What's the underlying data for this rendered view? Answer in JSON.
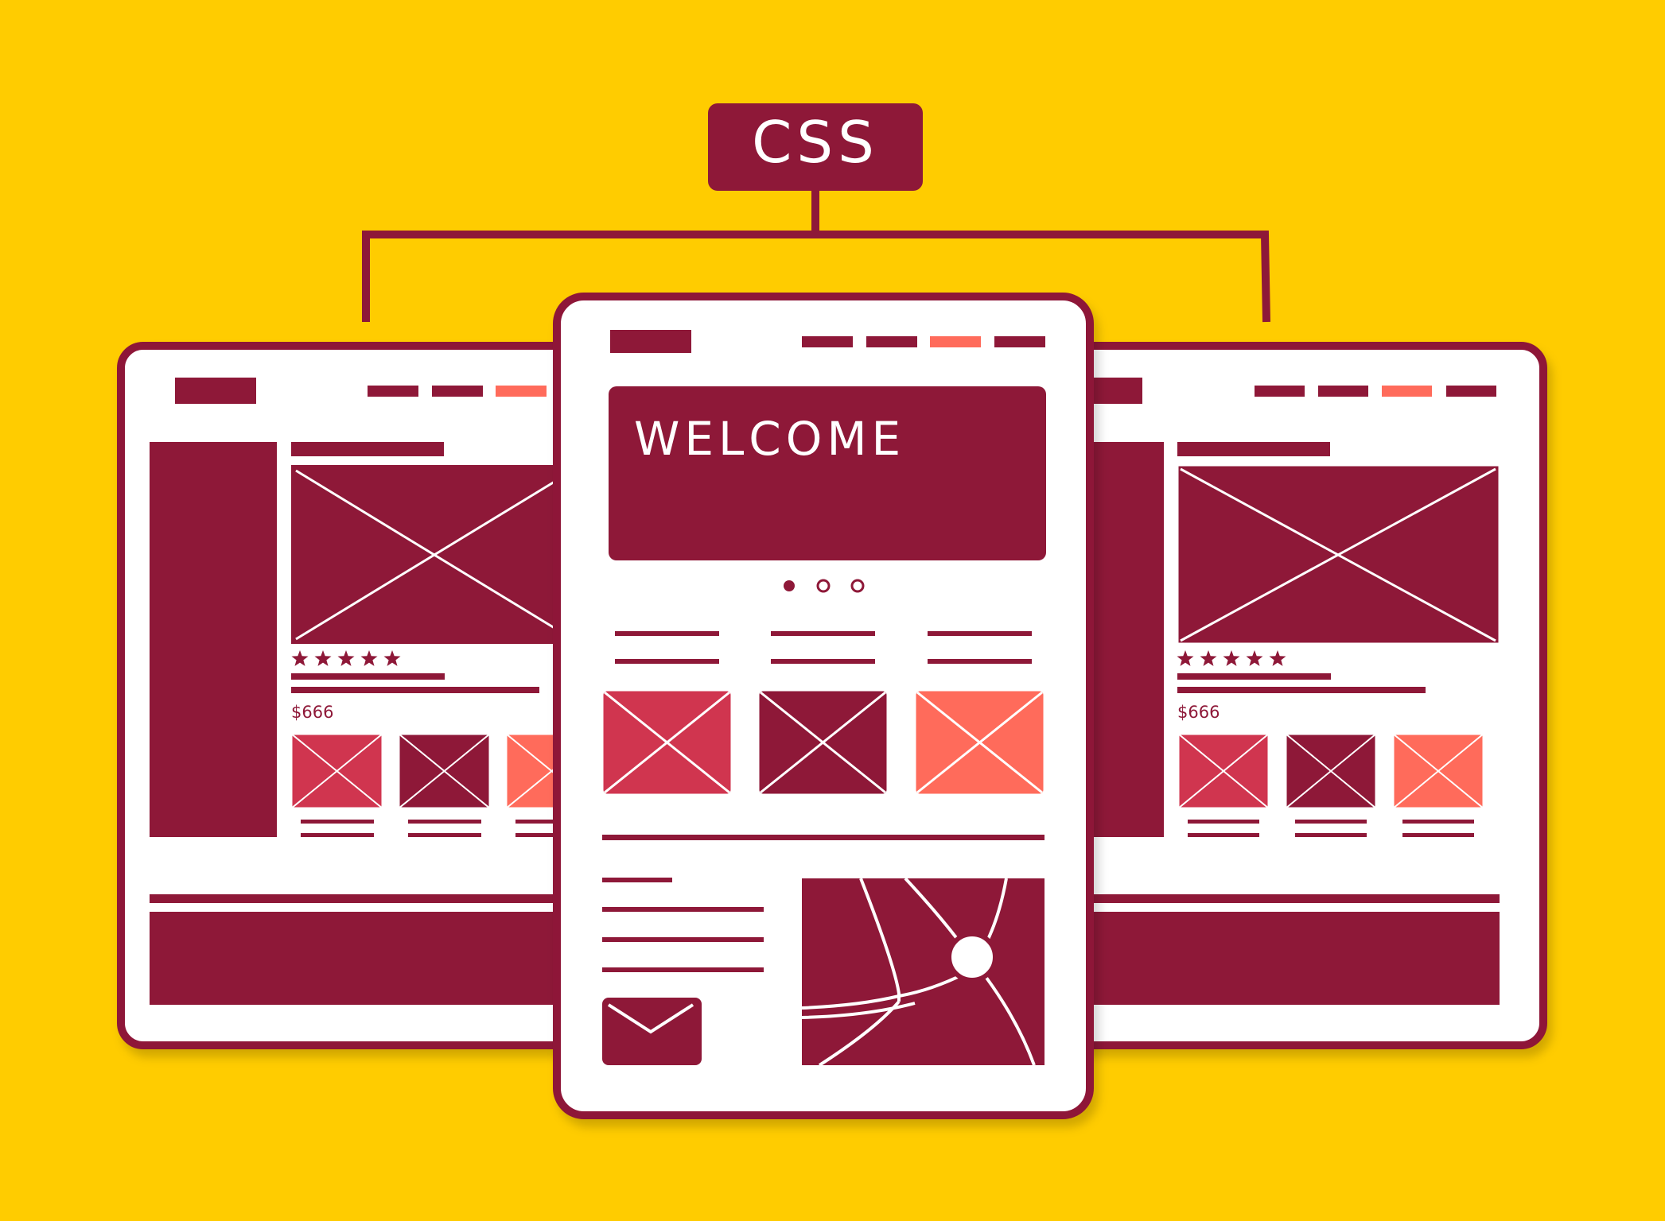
{
  "colors": {
    "background": "#FFCC00",
    "primary": "#8E1838",
    "accent": "#FF6B5B",
    "mid": "#D0354F",
    "white": "#FFFFFF"
  },
  "css_label": "CSS",
  "welcome_text": "WELCOME",
  "price_text": "$666",
  "rating_stars": 5,
  "carousel": {
    "count": 3,
    "active": 1
  },
  "nav_items": 4,
  "nav_active_index": 2,
  "icons": {
    "css": "css-badge",
    "image_placeholder": "image-placeholder-icon",
    "star": "star-icon",
    "mail": "mail-icon",
    "map": "map-icon"
  }
}
